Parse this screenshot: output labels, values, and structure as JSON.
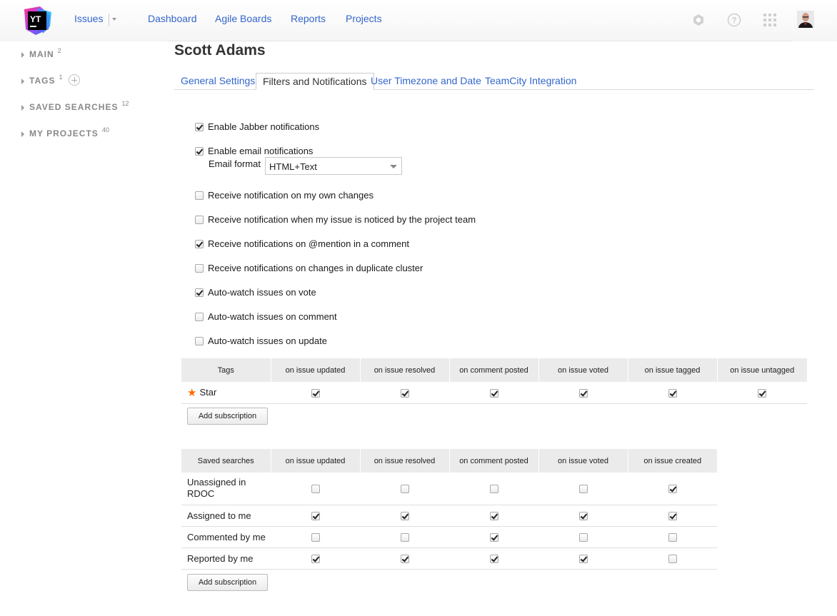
{
  "header": {
    "issues": "Issues",
    "nav": [
      "Dashboard",
      "Agile Boards",
      "Reports",
      "Projects"
    ],
    "icons": [
      "settings-icon",
      "help-icon",
      "apps-grid-icon"
    ]
  },
  "sidebar": [
    {
      "label": "MAIN",
      "count": "2"
    },
    {
      "label": "TAGS",
      "count": "1"
    },
    {
      "label": "SAVED SEARCHES",
      "count": "12"
    },
    {
      "label": "MY PROJECTS",
      "count": "40"
    }
  ],
  "page": {
    "title": "Scott Adams"
  },
  "tabs": [
    "General Settings",
    "Filters and Notifications",
    "User Timezone and Date",
    "TeamCity Integration"
  ],
  "active_tab": "Filters and Notifications",
  "options": [
    {
      "label": "Enable Jabber notifications",
      "checked": true
    },
    {
      "label": "Enable email notifications",
      "checked": true
    },
    {
      "label": "Receive notification on my own changes",
      "checked": false
    },
    {
      "label": "Receive notification when my issue is noticed by the project team",
      "checked": false
    },
    {
      "label": "Receive notifications on @mention in a comment",
      "checked": true
    },
    {
      "label": "Receive notifications on changes in duplicate cluster",
      "checked": false
    },
    {
      "label": "Auto-watch issues on vote",
      "checked": true
    },
    {
      "label": "Auto-watch issues on comment",
      "checked": false
    },
    {
      "label": "Auto-watch issues on update",
      "checked": false
    }
  ],
  "email_format": {
    "label": "Email format",
    "value": "HTML+Text"
  },
  "tags_table": {
    "headers": [
      "Tags",
      "on issue updated",
      "on issue resolved",
      "on comment posted",
      "on issue voted",
      "on issue tagged",
      "on issue untagged"
    ],
    "rows": [
      {
        "name": "Star",
        "checks": [
          true,
          true,
          true,
          true,
          true,
          true
        ]
      }
    ],
    "button": "Add subscription"
  },
  "searches_table": {
    "headers": [
      "Saved searches",
      "on issue updated",
      "on issue resolved",
      "on comment posted",
      "on issue voted",
      "on issue created"
    ],
    "rows": [
      {
        "name": "Unassigned in RDOC",
        "checks": [
          false,
          false,
          false,
          false,
          true
        ]
      },
      {
        "name": "Assigned to me",
        "checks": [
          true,
          true,
          true,
          true,
          true
        ]
      },
      {
        "name": "Commented by me",
        "checks": [
          false,
          false,
          true,
          false,
          false
        ]
      },
      {
        "name": "Reported by me",
        "checks": [
          true,
          true,
          true,
          true,
          false
        ]
      }
    ],
    "button": "Add subscription"
  }
}
